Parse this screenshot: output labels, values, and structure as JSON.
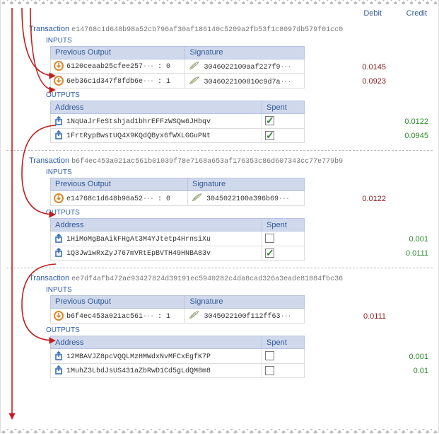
{
  "header": {
    "debit": "Debit",
    "credit": "Credit"
  },
  "tx_label": "Transaction",
  "labels": {
    "inputs": "INPUTS",
    "outputs": "OUTPUTS",
    "prev_output": "Previous Output",
    "signature": "Signature",
    "address": "Address",
    "spent": "Spent"
  },
  "transactions": [
    {
      "hash": "e14768c1d648b98a52cb796af30af186140c5209a2fb53f1c8097db579f01cc0",
      "inputs": [
        {
          "prev": "6120ceaab25cfee257",
          "idx": "0",
          "sig": "3046022100aaf227f9",
          "debit": "0.0145"
        },
        {
          "prev": "6eb36c1d347f8fdb6e",
          "idx": "1",
          "sig": "3046022100810c9d7a",
          "debit": "0.0923"
        }
      ],
      "outputs": [
        {
          "addr": "1NqUaJrFeStshjad1bhrEFFzWSQw6JHbqv",
          "spent": true,
          "credit": "0.0122"
        },
        {
          "addr": "1FrtRypBwstUQ4X9KQdQByx6fWXLGGuPNt",
          "spent": true,
          "credit": "0.0945"
        }
      ]
    },
    {
      "hash": "b6f4ec453a021ac561b01039f78e7168a653af176353c86d607343cc77e779b9",
      "inputs": [
        {
          "prev": "e14768c1d648b98a52",
          "idx": "0",
          "sig": "3045022100a396b69",
          "debit": "0.0122"
        }
      ],
      "outputs": [
        {
          "addr": "1HiMoMgBaAikFHgAt3M4YJtetp4HrnsiXu",
          "spent": false,
          "credit": "0.001"
        },
        {
          "addr": "1Q3Jw1wRxZyJ767mVRtEpBVTH49HNBA83v",
          "spent": true,
          "credit": "0.0111"
        }
      ]
    },
    {
      "hash": "ee7df4afb472ae93427824d39191ec5940282c4da8cad326a3eade81884fbc36",
      "inputs": [
        {
          "prev": "b6f4ec453a021ac561",
          "idx": "1",
          "sig": "3045022100f112ff63",
          "debit": "0.0111"
        }
      ],
      "outputs": [
        {
          "addr": "12MBAVJZ8pcVQQLMzHMWdxNvMFCxEgfK7P",
          "spent": false,
          "credit": "0.001"
        },
        {
          "addr": "1MuhZ3LbdJsUS431aZbRwD1Cd5gLdQM8m8",
          "spent": false,
          "credit": "0.01"
        }
      ]
    }
  ]
}
